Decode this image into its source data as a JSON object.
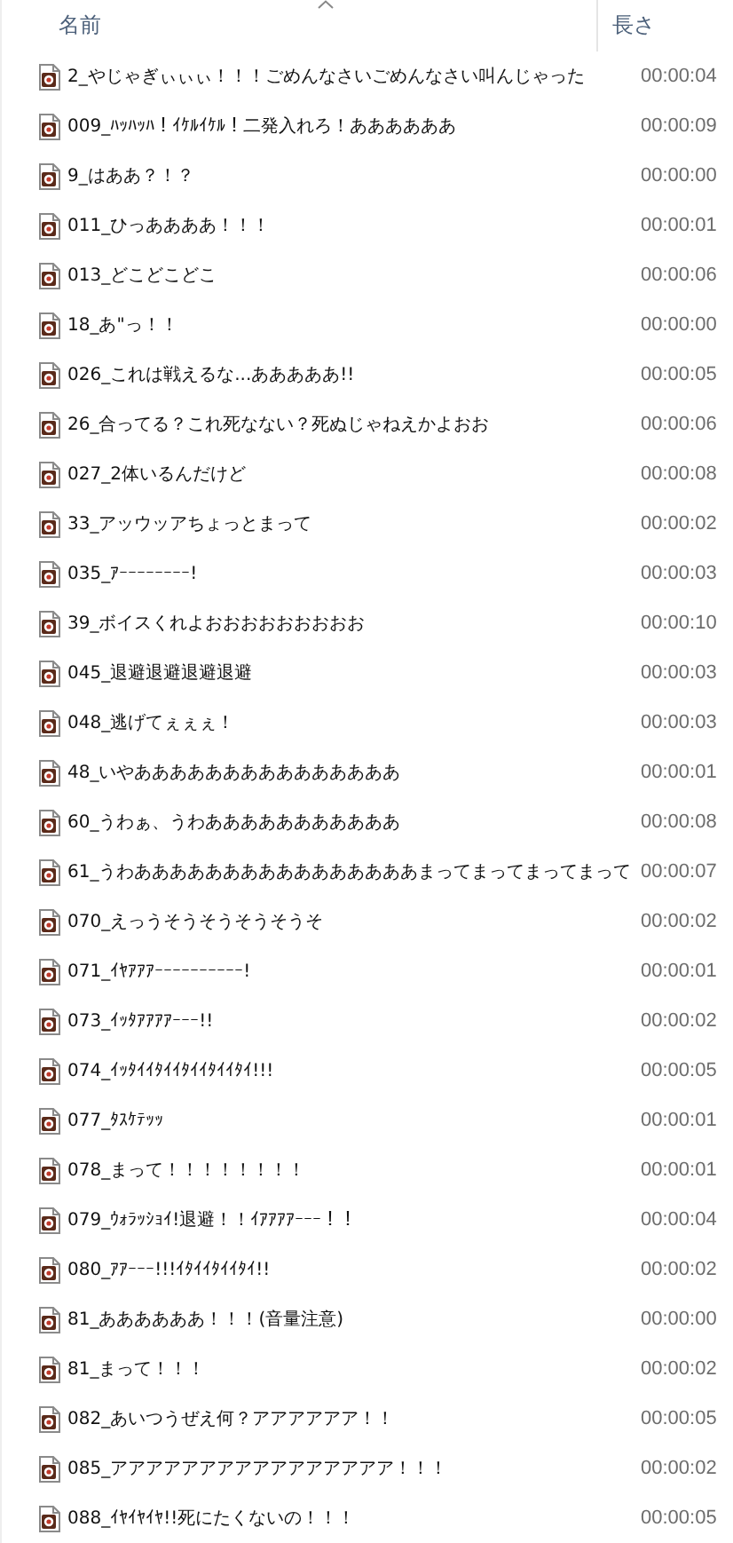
{
  "columns": [
    {
      "label": "名前",
      "sorted": true
    },
    {
      "label": "長さ",
      "sorted": false
    }
  ],
  "files": [
    {
      "name": "2_やじゃぎぃぃぃ！！！ごめんなさいごめんなさい叫んじゃった",
      "length": "00:00:04"
    },
    {
      "name": "009_ﾊｯﾊｯﾊ！ｲｹﾙｲｹﾙ！二発入れろ！ああああああ",
      "length": "00:00:09"
    },
    {
      "name": "9_はああ？！？",
      "length": "00:00:00"
    },
    {
      "name": "011_ひっああああ！！！",
      "length": "00:00:01"
    },
    {
      "name": "013_どこどこどこ",
      "length": "00:00:06"
    },
    {
      "name": "18_あ\"っ！！",
      "length": "00:00:00"
    },
    {
      "name": "026_これは戦えるな...あああああ!!",
      "length": "00:00:05"
    },
    {
      "name": "26_合ってる？これ死なない？死ぬじゃねえかよおお",
      "length": "00:00:06"
    },
    {
      "name": "027_2体いるんだけど",
      "length": "00:00:08"
    },
    {
      "name": "33_アッウッアちょっとまって",
      "length": "00:00:02"
    },
    {
      "name": "035_ｱｰｰｰｰｰｰｰｰ!",
      "length": "00:00:03"
    },
    {
      "name": "39_ボイスくれよおおおおおおおおお",
      "length": "00:00:10"
    },
    {
      "name": "045_退避退避退避退避",
      "length": "00:00:03"
    },
    {
      "name": "048_逃げてぇぇぇ！",
      "length": "00:00:03"
    },
    {
      "name": "48_いやあああああああああああああああ",
      "length": "00:00:01"
    },
    {
      "name": "60_うわぁ、うわあああああああああああ",
      "length": "00:00:08"
    },
    {
      "name": "61_うわああああああああああああああああまってまってまってまって",
      "length": "00:00:07"
    },
    {
      "name": "070_えっうそうそうそうそうそ",
      "length": "00:00:02"
    },
    {
      "name": "071_ｲﾔｱｱｱｰｰｰｰｰｰｰｰｰｰ!",
      "length": "00:00:01"
    },
    {
      "name": "073_ｲｯﾀｱｱｱｱｰｰｰ!!",
      "length": "00:00:02"
    },
    {
      "name": "074_ｲｯﾀｲｲﾀｲｲﾀｲｲﾀｲｲﾀｲ!!!",
      "length": "00:00:05"
    },
    {
      "name": "077_ﾀｽｹﾃｯｯ",
      "length": "00:00:01"
    },
    {
      "name": "078_まって！！！！！！！！",
      "length": "00:00:01"
    },
    {
      "name": "079_ｳｫﾗｯｼｮｲ!退避！！ｲｱｱｱｱｰｰｰ！！",
      "length": "00:00:04"
    },
    {
      "name": "080_ｱｱｰｰｰ!!!ｲﾀｲｲﾀｲｲﾀｲ!!",
      "length": "00:00:02"
    },
    {
      "name": "81_ああああああ！！！(音量注意)",
      "length": "00:00:00"
    },
    {
      "name": "81_まって！！！",
      "length": "00:00:02"
    },
    {
      "name": "082_あいつうぜえ何？アアアアアア！！",
      "length": "00:00:05"
    },
    {
      "name": "085_アアアアアアアアアアアアアアアア！！！",
      "length": "00:00:02"
    },
    {
      "name": "088_ｲﾔｲﾔｲﾔ!!死にたくないの！！！",
      "length": "00:00:05"
    }
  ]
}
